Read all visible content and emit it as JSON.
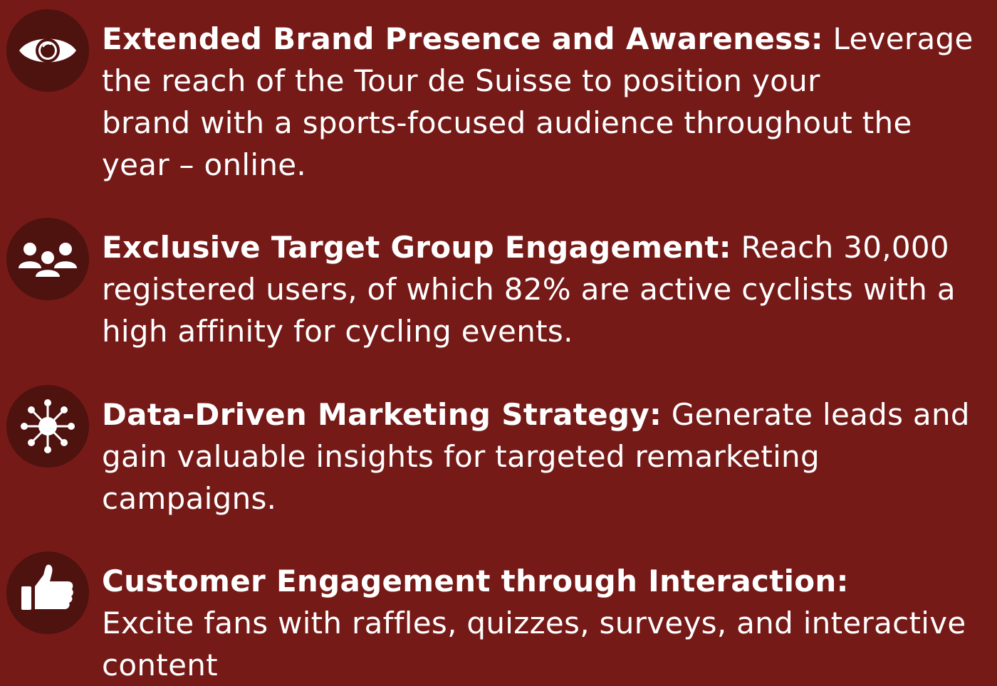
{
  "benefits": [
    {
      "icon": "eye-icon",
      "title": "Extended Brand Presence and Awareness:",
      "lines": [
        "Leverage",
        "the reach of the Tour de Suisse to position your",
        "brand with a sports-focused audience throughout the",
        "year – online."
      ]
    },
    {
      "icon": "users-group-icon",
      "title": "Exclusive Target Group Engagement:",
      "lines": [
        "Reach 30,000",
        "registered users, of which 82% are active cyclists with a",
        "high affinity for cycling events."
      ]
    },
    {
      "icon": "network-icon",
      "title": "Data-Driven Marketing Strategy:",
      "lines": [
        "Generate leads and",
        "gain valuable insights for targeted remarketing",
        "campaigns."
      ]
    },
    {
      "icon": "thumbs-up-icon",
      "title": "Customer Engagement through Interaction:",
      "lines": [
        "",
        "Excite fans with raffles, quizzes, surveys, and interactive",
        "content"
      ]
    }
  ],
  "colors": {
    "background": "#761a18",
    "icon_circle": "#4e120f",
    "text": "#ffffff"
  }
}
